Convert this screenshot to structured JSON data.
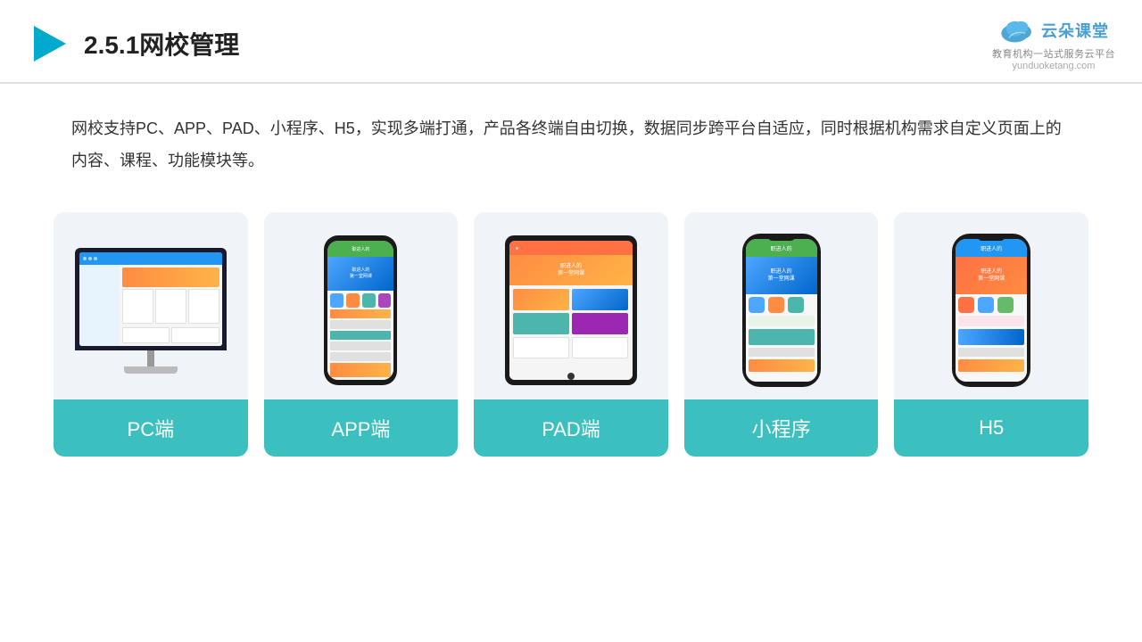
{
  "header": {
    "title": "2.5.1网校管理",
    "logo_text": "云朵课堂",
    "logo_url": "yunduoketang.com",
    "logo_sub": "教育机构一站式服务云平台"
  },
  "description": {
    "text": "网校支持PC、APP、PAD、小程序、H5，实现多端打通，产品各终端自由切换，数据同步跨平台自适应，同时根据机构需求自定义页面上的内容、课程、功能模块等。"
  },
  "cards": [
    {
      "id": "pc",
      "label": "PC端"
    },
    {
      "id": "app",
      "label": "APP端"
    },
    {
      "id": "pad",
      "label": "PAD端"
    },
    {
      "id": "miniapp",
      "label": "小程序"
    },
    {
      "id": "h5",
      "label": "H5"
    }
  ]
}
